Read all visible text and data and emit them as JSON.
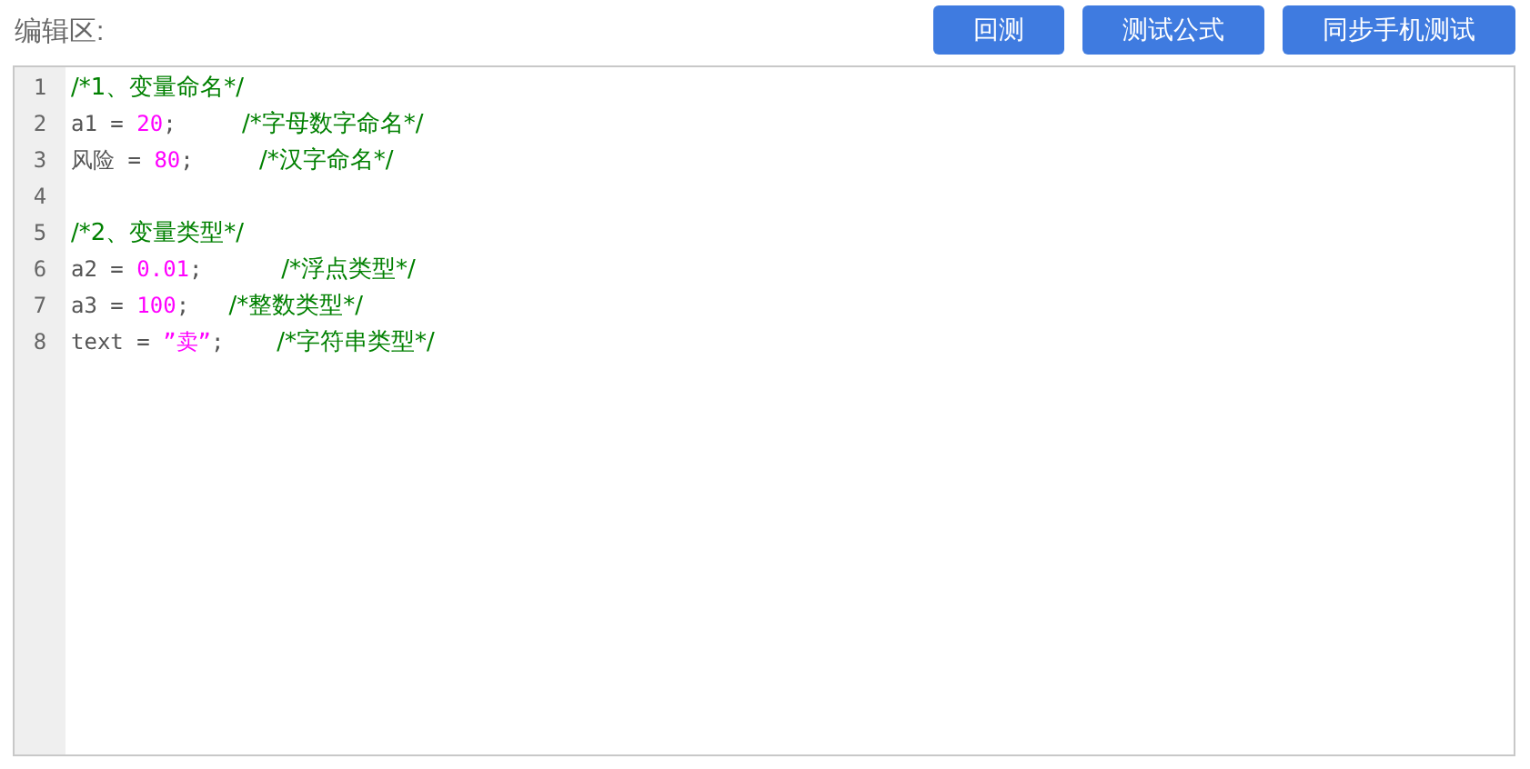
{
  "header": {
    "label": "编辑区:"
  },
  "buttons": [
    {
      "label": "回测"
    },
    {
      "label": "测试公式"
    },
    {
      "label": "同步手机测试"
    }
  ],
  "editor": {
    "lines": [
      {
        "number": "1",
        "tokens": [
          {
            "kind": "comment",
            "text": "/*1、变量命名*/"
          }
        ]
      },
      {
        "number": "2",
        "tokens": [
          {
            "kind": "plain",
            "text": "a1 = "
          },
          {
            "kind": "number",
            "text": "20"
          },
          {
            "kind": "plain",
            "text": ";     "
          },
          {
            "kind": "comment",
            "text": "/*字母数字命名*/"
          }
        ]
      },
      {
        "number": "3",
        "tokens": [
          {
            "kind": "plain",
            "text": "风险 = "
          },
          {
            "kind": "number",
            "text": "80"
          },
          {
            "kind": "plain",
            "text": ";     "
          },
          {
            "kind": "comment",
            "text": "/*汉字命名*/"
          }
        ]
      },
      {
        "number": "4"
      },
      {
        "number": "5",
        "tokens": [
          {
            "kind": "comment",
            "text": "/*2、变量类型*/"
          }
        ]
      },
      {
        "number": "6",
        "tokens": [
          {
            "kind": "plain",
            "text": "a2 = "
          },
          {
            "kind": "number",
            "text": "0.01"
          },
          {
            "kind": "plain",
            "text": ";      "
          },
          {
            "kind": "comment",
            "text": "/*浮点类型*/"
          }
        ]
      },
      {
        "number": "7",
        "tokens": [
          {
            "kind": "plain",
            "text": "a3 = "
          },
          {
            "kind": "number",
            "text": "100"
          },
          {
            "kind": "plain",
            "text": ";   "
          },
          {
            "kind": "comment",
            "text": "/*整数类型*/"
          }
        ]
      },
      {
        "number": "8",
        "tokens": [
          {
            "kind": "plain",
            "text": "text = "
          },
          {
            "kind": "string",
            "text": "”卖”"
          },
          {
            "kind": "plain",
            "text": ";    "
          },
          {
            "kind": "comment",
            "text": "/*字符串类型*/"
          }
        ]
      }
    ]
  }
}
